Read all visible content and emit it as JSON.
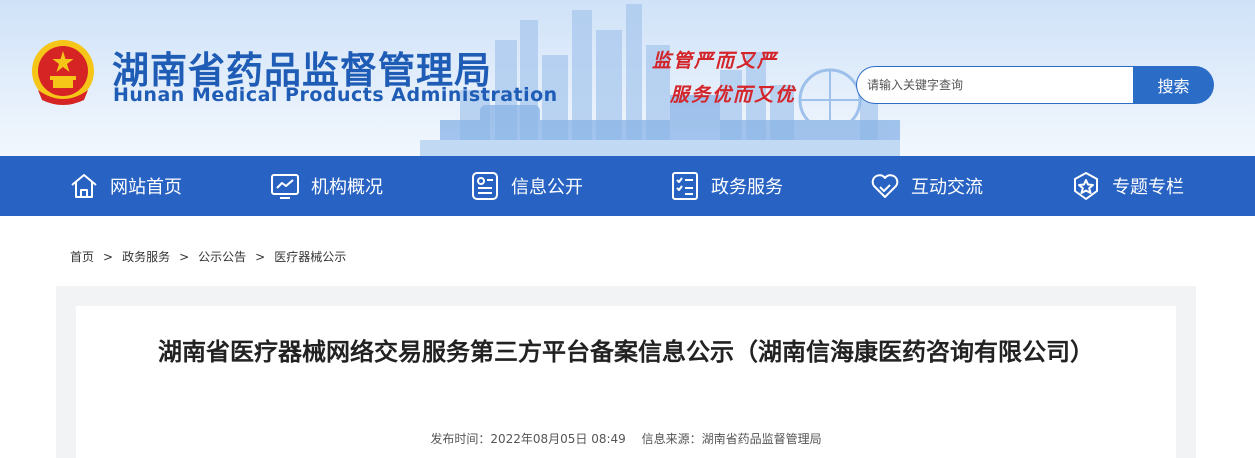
{
  "header": {
    "title": "湖南省药品监督管理局",
    "subtitle": "Hunan Medical Products Administration",
    "slogan_line1": "监管严而又严",
    "slogan_line2": "服务优而又优",
    "emblem_icon": "national-emblem-icon"
  },
  "search": {
    "placeholder": "请输入关键字查询",
    "button_label": "搜索"
  },
  "nav": {
    "items": [
      {
        "label": "网站首页",
        "icon": "home-icon"
      },
      {
        "label": "机构概况",
        "icon": "chart-monitor-icon"
      },
      {
        "label": "信息公开",
        "icon": "id-card-icon"
      },
      {
        "label": "政务服务",
        "icon": "checklist-icon"
      },
      {
        "label": "互动交流",
        "icon": "heart-hands-icon"
      },
      {
        "label": "专题专栏",
        "icon": "star-badge-icon"
      }
    ]
  },
  "breadcrumb": {
    "items": [
      "首页",
      "政务服务",
      "公示公告",
      "医疗器械公示"
    ],
    "separator": ">"
  },
  "article": {
    "title": "湖南省医疗器械网络交易服务第三方平台备案信息公示（湖南信海康医药咨询有限公司）",
    "publish_time": "发布时间：2022年08月05日 08:49",
    "source": "信息来源：湖南省药品监督管理局"
  },
  "colors": {
    "brand_blue": "#2863c3",
    "title_blue": "#1f5cb6",
    "slogan_red": "#d4252b"
  }
}
